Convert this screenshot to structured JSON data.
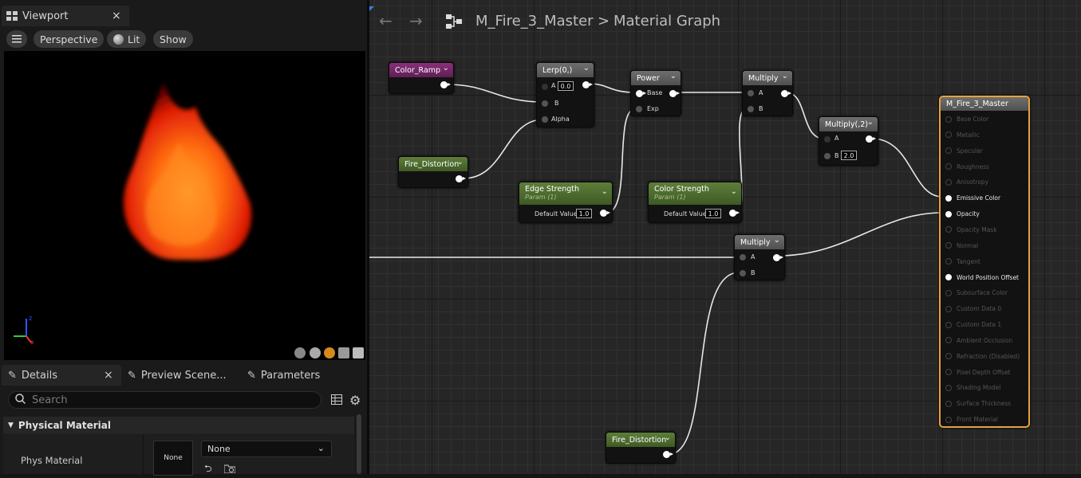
{
  "viewport_tab": {
    "title": "Viewport",
    "close": "×"
  },
  "viewport_toolbar": {
    "perspective": "Perspective",
    "lit": "Lit",
    "show": "Show"
  },
  "details_tabs": [
    {
      "label": "Details",
      "close": "×"
    },
    {
      "label": "Preview Scene..."
    },
    {
      "label": "Parameters"
    }
  ],
  "details": {
    "search_placeholder": "Search",
    "category": "Physical Material",
    "prop_label": "Phys Material",
    "thumb_label": "None",
    "dropdown_value": "None"
  },
  "graph_header": {
    "asset": "M_Fire_3_Master",
    "separator": ">",
    "graph": "Material Graph"
  },
  "nodes": {
    "color_ramp": {
      "title": "Color_Ramp"
    },
    "lerp": {
      "title": "Lerp(0,)",
      "pin_a": "A",
      "a_value": "0.0",
      "pin_b": "B",
      "pin_alpha": "Alpha"
    },
    "power": {
      "title": "Power",
      "pin_base": "Base",
      "pin_exp": "Exp"
    },
    "multiply1": {
      "title": "Multiply",
      "pin_a": "A",
      "pin_b": "B"
    },
    "multiply2": {
      "title": "Multiply(,2)",
      "pin_a": "A",
      "pin_b": "B",
      "b_value": "2.0"
    },
    "fire_distortion1": {
      "title": "Fire_Distortion"
    },
    "edge_strength": {
      "title": "Edge Strength",
      "sub": "Param (1)",
      "default_label": "Default Value",
      "default_value": "1.0"
    },
    "color_strength": {
      "title": "Color Strength",
      "sub": "Param (1)",
      "default_label": "Default Value",
      "default_value": "1.0"
    },
    "multiply3": {
      "title": "Multiply",
      "pin_a": "A",
      "pin_b": "B"
    },
    "fire_distortion2": {
      "title": "Fire_Distortion"
    }
  },
  "material_node": {
    "title": "M_Fire_3_Master",
    "inputs": [
      {
        "label": "Base Color",
        "active": false
      },
      {
        "label": "Metallic",
        "active": false
      },
      {
        "label": "Specular",
        "active": false
      },
      {
        "label": "Roughness",
        "active": false
      },
      {
        "label": "Anisotropy",
        "active": false
      },
      {
        "label": "Emissive Color",
        "active": true
      },
      {
        "label": "Opacity",
        "active": true
      },
      {
        "label": "Opacity Mask",
        "active": false
      },
      {
        "label": "Normal",
        "active": false
      },
      {
        "label": "Tangent",
        "active": false
      },
      {
        "label": "World Position Offset",
        "active": true
      },
      {
        "label": "Subsurface Color",
        "active": false
      },
      {
        "label": "Custom Data 0",
        "active": false
      },
      {
        "label": "Custom Data 1",
        "active": false
      },
      {
        "label": "Ambient Occlusion",
        "active": false
      },
      {
        "label": "Refraction (Disabled)",
        "active": false
      },
      {
        "label": "Pixel Depth Offset",
        "active": false
      },
      {
        "label": "Shading Model",
        "active": false
      },
      {
        "label": "Surface Thickness",
        "active": false
      },
      {
        "label": "Front Material",
        "active": false
      }
    ]
  },
  "colors": {
    "node_green": "#5d7e3a",
    "node_purple": "#8a2f7a",
    "selection_orange": "#e8a13a"
  }
}
